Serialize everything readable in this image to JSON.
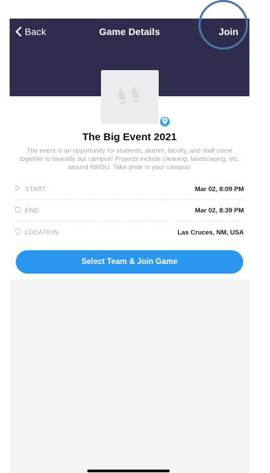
{
  "navbar": {
    "back_label": "Back",
    "title": "Game Details",
    "join_label": "Join"
  },
  "event": {
    "title": "The Big Event 2021",
    "description": "The event is an opportunity for students, alumni, faculty, and staff come together to beautify our campus! Projects include cleaning, landscaping, etc. around NMSU. Take pride in your campus!"
  },
  "details": [
    {
      "label": "START",
      "value": "Mar 02, 8:09 PM",
      "icon": "play-icon"
    },
    {
      "label": "END",
      "value": "Mar 02, 8:39 PM",
      "icon": "stop-icon"
    },
    {
      "label": "LOCATION",
      "value": "Las Cruces, NM, USA",
      "icon": "location-pin-icon"
    }
  ],
  "cta": {
    "label": "Select Team & Join Game"
  },
  "colors": {
    "navbar_bg": "#2f2d4d",
    "accent": "#2a96ef",
    "highlight_circle": "#4c73aa"
  }
}
